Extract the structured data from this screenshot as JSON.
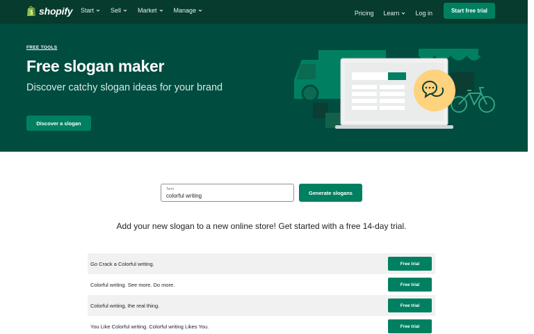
{
  "nav": {
    "logo_text": "shopify",
    "menu": [
      {
        "label": "Start"
      },
      {
        "label": "Sell"
      },
      {
        "label": "Market"
      },
      {
        "label": "Manage"
      }
    ],
    "pricing": "Pricing",
    "learn": "Learn",
    "login": "Log in",
    "cta": "Start free trial"
  },
  "hero": {
    "eyebrow": "FREE TOOLS",
    "title": "Free slogan maker",
    "subtitle": "Discover catchy slogan ideas for your brand",
    "button": "Discover a slogan"
  },
  "form": {
    "label": "Term",
    "value": "colorful writing",
    "button": "Generate slogans"
  },
  "promo": "Add your new slogan to a new online store! Get started with a free 14-day trial.",
  "slogans": [
    {
      "text": "Go Crack a Colorful writing.",
      "button": "Free trial"
    },
    {
      "text": "Colorful writing. See more. Do more.",
      "button": "Free trial"
    },
    {
      "text": "Colorful writing, the real thing.",
      "button": "Free trial"
    },
    {
      "text": "You Like Colorful writing. Colorful writing Likes You.",
      "button": "Free trial"
    }
  ],
  "colors": {
    "nav_bg": "#063b2d",
    "hero_bg": "#004c3f",
    "accent": "#008060"
  },
  "icons": {
    "logo": "shopify-bag-icon",
    "menu_chevron": "chevron-down-icon",
    "illustration": "storefront-laptop-illustration",
    "chat": "chat-bubbles-icon"
  }
}
